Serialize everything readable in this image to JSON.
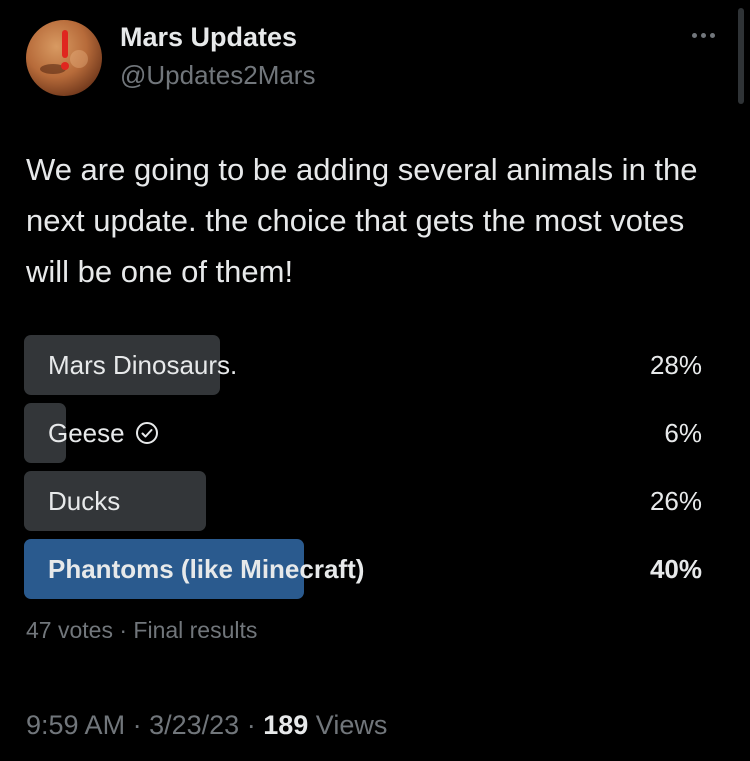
{
  "author": {
    "display_name": "Mars Updates",
    "handle": "@Updates2Mars",
    "avatar_icon": "mars-planet-icon"
  },
  "tweet": {
    "text": "We are going to be adding several animals in the next update. the choice that gets the most votes will be one of them!"
  },
  "poll": {
    "options": [
      {
        "label": "Mars Dinosaurs.",
        "percent_label": "28%",
        "percent": 28,
        "selected": false,
        "winner": false
      },
      {
        "label": "Geese",
        "percent_label": "6%",
        "percent": 6,
        "selected": true,
        "winner": false
      },
      {
        "label": "Ducks",
        "percent_label": "26%",
        "percent": 26,
        "selected": false,
        "winner": false
      },
      {
        "label": "Phantoms (like Minecraft)",
        "percent_label": "40%",
        "percent": 40,
        "selected": false,
        "winner": true
      }
    ],
    "votes": "47 votes",
    "separator": "·",
    "status": "Final results"
  },
  "meta": {
    "time": "9:59 AM",
    "date": "3/23/23",
    "separator": "·",
    "views_count": "189",
    "views_label": "Views"
  },
  "colors": {
    "background": "#000000",
    "bar": "#333639",
    "winner_bar": "#2a5a8e",
    "secondary_text": "#71767b"
  }
}
